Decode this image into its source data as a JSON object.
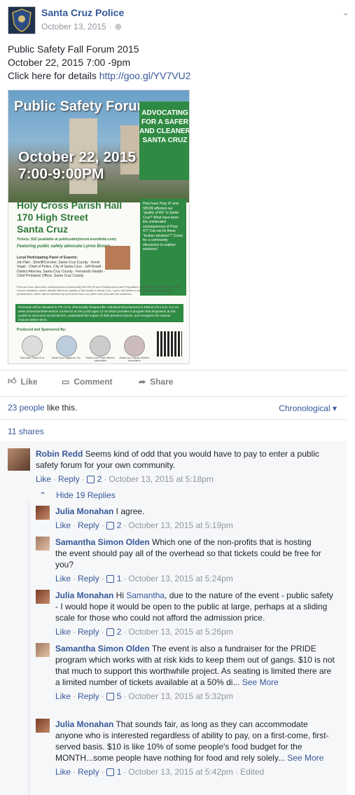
{
  "post": {
    "page_name": "Santa Cruz Police",
    "date": "October 13, 2015",
    "text_line1": "Public Safety Fall Forum 2015",
    "text_line2": "October 22, 2015 7:00 -9pm",
    "text_line3_prefix": "Click here for details ",
    "text_line3_link": "http://goo.gl/YV7VU2"
  },
  "poster": {
    "title": "Public Safety Forum",
    "green_tag": "ADVOCATING FOR A SAFER AND CLEANER SANTA CRUZ",
    "date_line1": "October 22, 2015",
    "date_line2": "7:00-9:00PM",
    "venue_line1": "Holy Cross Parish Hall",
    "venue_line2": "170 High Street",
    "venue_line3": "Santa Cruz",
    "tickets": "Tickets: $10 (available at publicsafetyforum.eventbrite.com)",
    "featuring": "Featuring public safety advocate Lynne Brown",
    "panel_title": "Local Participating Panel of Experts:",
    "panel": "Jim Hart - Sheriff/Coroner, Santa Cruz County · Kevin Vogel - Chief of Police, City of Santa Cruz · Jeff Rosell - District Attorney, Santa Cruz County · Fernando Giraldo - Chief Probation Officer, Santa Cruz County",
    "questions": "How have Prop 47 and SB109 affected our \"quality of life\" in Santa Cruz? What have been the unintended consequences of Prop 47? Can we fix these \"broken windows\"? Come for a community discussion to explore solutions!",
    "findout": "Find out more about the consequences of Assembly Bill 109 (Prison Realignment) and Proposition 47 (Reduced Penalties for Some Crimes Initiative), which directly affect our quality of life locally in Santa Cruz. Lynne will deliver a brief compelling multimedia presentation, which will be followed by comments from our panel and Q&A with the audience.",
    "proceeds": "Proceeds will be donated to P.R.I.D.E. (Personally Responsible Individual Development in Ethics) P.R.I.D.E. is a 12-week prevention/intervention course for at risk youth ages 12-15 which provides a program that empowers at risk youths to overcome social barriers, understand the impact of their present choices, and recognize the various choices before them.",
    "sponsored": "Produced and Sponsored By:",
    "logo_labels": [
      "Take Back Santa Cruz",
      "Santa Cruz Neighbors, Inc.",
      "Santa Cruz Police Officers Association",
      "Santa Cruz Deputy Sheriffs' Association"
    ]
  },
  "actions": {
    "like": "Like",
    "comment": "Comment",
    "share": "Share"
  },
  "likes": {
    "count_link": "23 people",
    "suffix": " like this."
  },
  "sort_label": "Chronological ▾",
  "shares": "11 shares",
  "hide_replies": "Hide 19 Replies",
  "comments": [
    {
      "author": "Robin Redd",
      "text": " Seems kind of odd that you would have to pay to enter a public safety forum for your own community.",
      "likes": "2",
      "time": "October 13, 2015 at 5:18pm",
      "edited": ""
    },
    {
      "author": "Julia Monahan",
      "text": " I agree.",
      "likes": "2",
      "time": "October 13, 2015 at 5:19pm",
      "edited": ""
    },
    {
      "author": "Samantha Simon Olden",
      "text": " Which one of the non-profits that is hosting the event should pay all of the overhead so that tickets could be free for you?",
      "likes": "1",
      "time": "October 13, 2015 at 5:24pm",
      "edited": ""
    },
    {
      "author": "Julia Monahan",
      "text_before": " Hi ",
      "mention": "Samantha",
      "text": ", due to the nature of the event - public safety - I would hope it would be open to the public at large, perhaps at a sliding scale for those who could not afford the admission price.",
      "likes": "2",
      "time": "October 13, 2015 at 5:26pm",
      "edited": ""
    },
    {
      "author": "Samantha Simon Olden",
      "text": " The event is also a fundraiser for the PRIDE program which works with at risk kids to keep them out of gangs. $10 is not that much to support this worthwhile project. As seating is limited there are a limited number of tickets available at a 50% di...",
      "see_more": " See More",
      "likes": "5",
      "time": "October 13, 2015 at 5:32pm",
      "edited": ""
    },
    {
      "author": "Julia Monahan",
      "text": " That sounds fair, as long as they can accommodate anyone who is interested regardless of ability to pay, on a first-come, first-served basis. $10 is like 10% of some people's food budget for the MONTH...some people have nothing for food and rely solely...",
      "see_more": " See More",
      "likes": "1",
      "time": "October 13, 2015 at 5:42pm",
      "edited": " · Edited"
    }
  ],
  "common": {
    "like": "Like",
    "reply": "Reply",
    "sep": " · "
  }
}
